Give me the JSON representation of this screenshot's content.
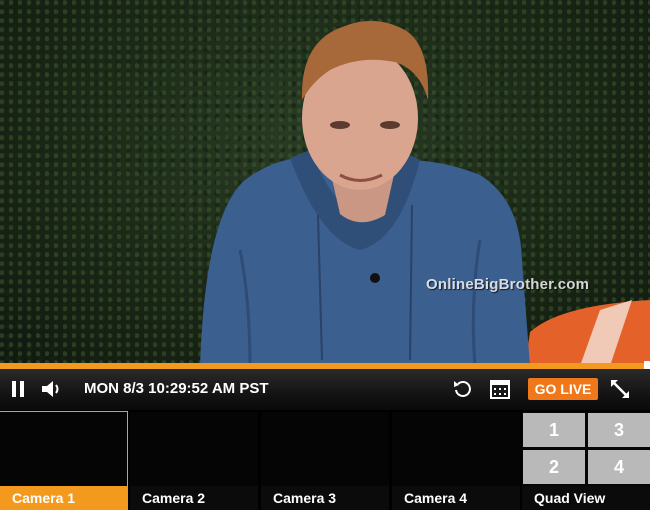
{
  "watermark": "OnlineBigBrother.com",
  "playback": {
    "progress_fraction": 0.995,
    "timestamp": "MON 8/3 10:29:52 AM PST",
    "go_live_label": "GO LIVE"
  },
  "icons": [
    "pause-icon",
    "volume-icon",
    "rewind-icon",
    "calendar-icon",
    "fullscreen-icon"
  ],
  "colors": {
    "accent": "#f39a1e",
    "go_live": "#f0781b"
  },
  "cameras": [
    {
      "label": "Camera 1",
      "active": true
    },
    {
      "label": "Camera 2",
      "active": false
    },
    {
      "label": "Camera 3",
      "active": false
    },
    {
      "label": "Camera 4",
      "active": false
    },
    {
      "label": "Quad View",
      "active": false
    }
  ],
  "quad_view": [
    "1",
    "3",
    "2",
    "4"
  ]
}
